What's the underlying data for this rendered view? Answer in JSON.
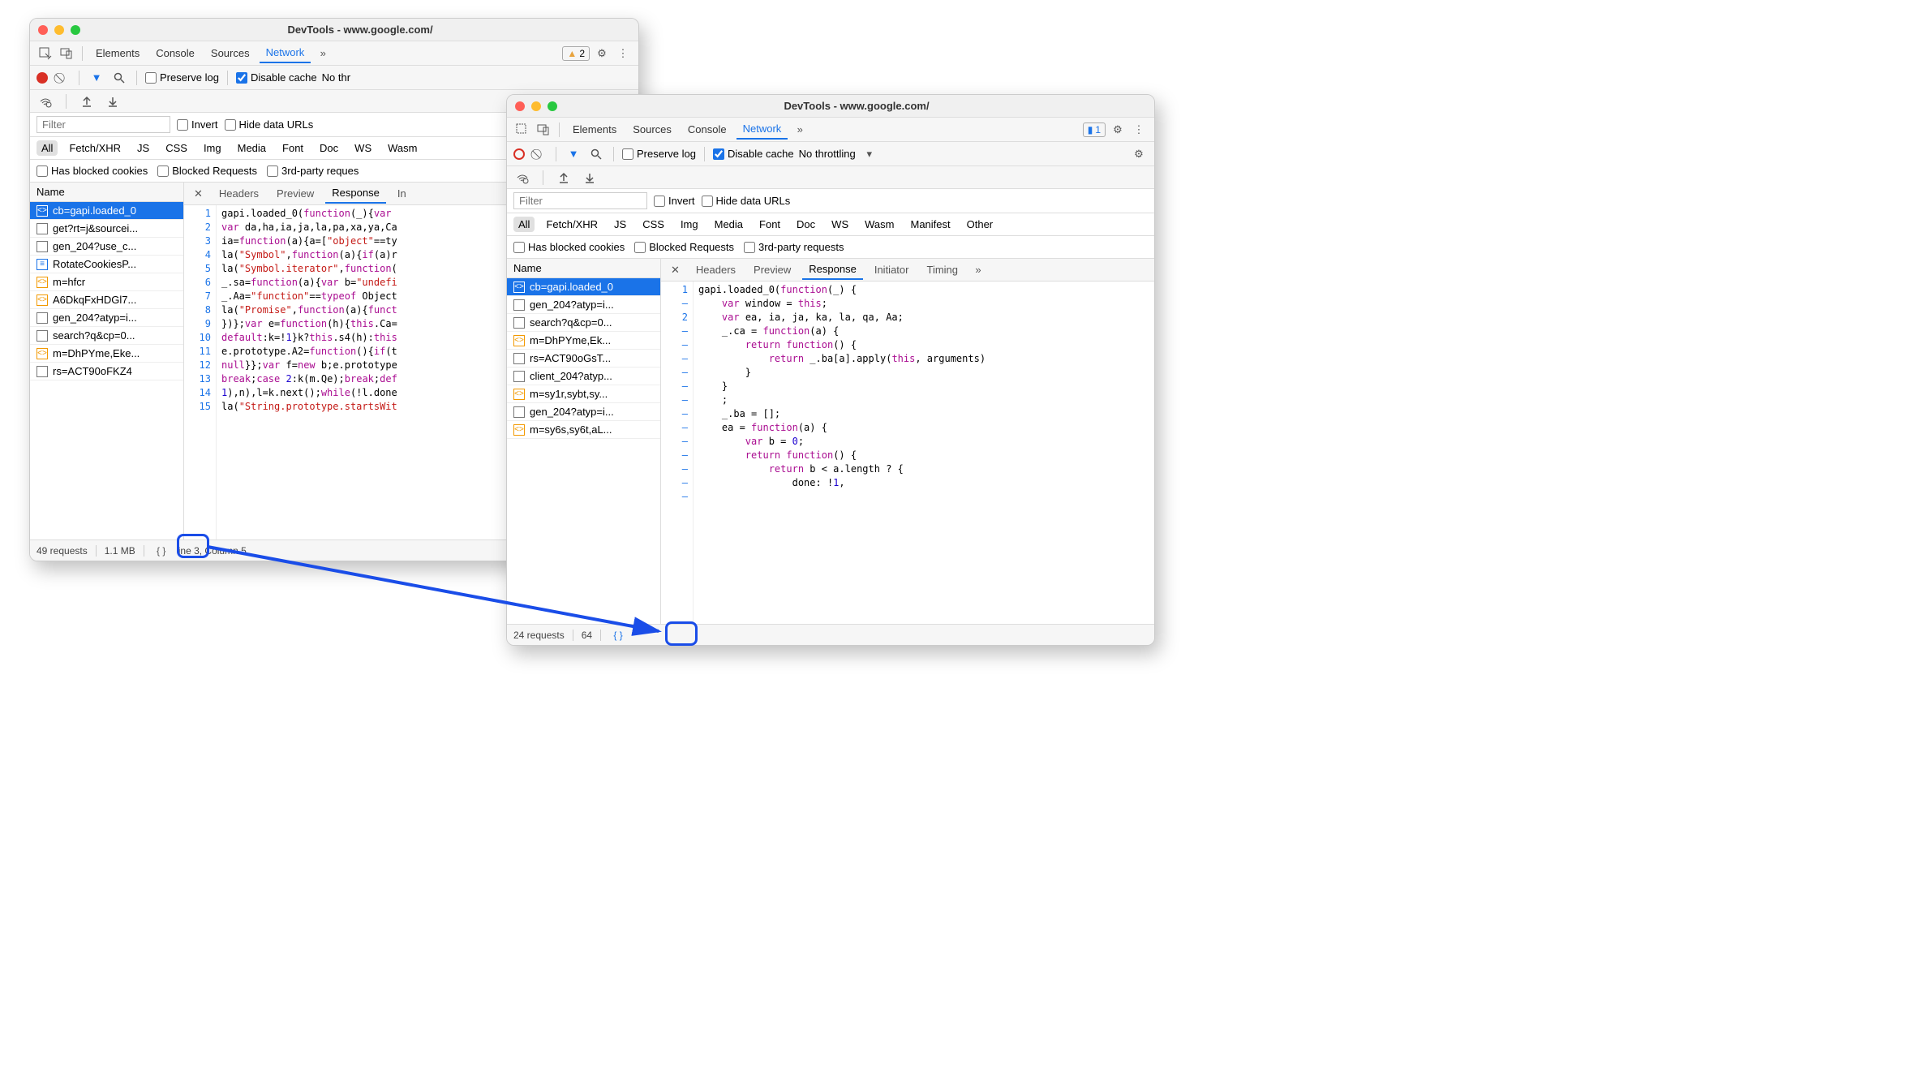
{
  "windowA": {
    "title": "DevTools - www.google.com/",
    "mainTabs": [
      "Elements",
      "Console",
      "Sources",
      "Network"
    ],
    "mainActive": "Network",
    "warnCount": "2",
    "preserveLog": "Preserve log",
    "disableCache": "Disable cache",
    "throttling": "No thr",
    "filterPlaceholder": "Filter",
    "invert": "Invert",
    "hideData": "Hide data URLs",
    "types": [
      "All",
      "Fetch/XHR",
      "JS",
      "CSS",
      "Img",
      "Media",
      "Font",
      "Doc",
      "WS",
      "Wasm"
    ],
    "typesActive": "All",
    "hasBlocked": "Has blocked cookies",
    "blockedReq": "Blocked Requests",
    "thirdParty": "3rd-party reques",
    "nameHead": "Name",
    "detailTabs": [
      "Headers",
      "Preview",
      "Response",
      "In"
    ],
    "detailActive": "Response",
    "files": [
      {
        "icon": "script",
        "label": "cb=gapi.loaded_0",
        "sel": true
      },
      {
        "icon": "doc",
        "label": "get?rt=j&sourcei..."
      },
      {
        "icon": "doc",
        "label": "gen_204?use_c..."
      },
      {
        "icon": "blue",
        "label": "RotateCookiesP..."
      },
      {
        "icon": "script",
        "label": "m=hfcr"
      },
      {
        "icon": "script",
        "label": "A6DkqFxHDGl7..."
      },
      {
        "icon": "doc",
        "label": "gen_204?atyp=i..."
      },
      {
        "icon": "doc",
        "label": "search?q&cp=0..."
      },
      {
        "icon": "script",
        "label": "m=DhPYme,Eke..."
      },
      {
        "icon": "doc",
        "label": "rs=ACT90oFKZ4"
      }
    ],
    "gutter": [
      "1",
      "2",
      "3",
      "4",
      "5",
      "6",
      "7",
      "8",
      "9",
      "10",
      "11",
      "12",
      "13",
      "14",
      "15"
    ],
    "status": {
      "requests": "49 requests",
      "transfer": "1.1 MB",
      "cursor": "ine 3, Column 5"
    }
  },
  "windowB": {
    "title": "DevTools - www.google.com/",
    "mainTabs": [
      "Elements",
      "Sources",
      "Console",
      "Network"
    ],
    "mainActive": "Network",
    "msgCount": "1",
    "preserveLog": "Preserve log",
    "disableCache": "Disable cache",
    "throttling": "No throttling",
    "filterPlaceholder": "Filter",
    "invert": "Invert",
    "hideData": "Hide data URLs",
    "types": [
      "All",
      "Fetch/XHR",
      "JS",
      "CSS",
      "Img",
      "Media",
      "Font",
      "Doc",
      "WS",
      "Wasm",
      "Manifest",
      "Other"
    ],
    "typesActive": "All",
    "hasBlocked": "Has blocked cookies",
    "blockedReq": "Blocked Requests",
    "thirdParty": "3rd-party requests",
    "nameHead": "Name",
    "detailTabs": [
      "Headers",
      "Preview",
      "Response",
      "Initiator",
      "Timing"
    ],
    "detailActive": "Response",
    "files": [
      {
        "icon": "script",
        "label": "cb=gapi.loaded_0",
        "sel": true
      },
      {
        "icon": "doc",
        "label": "gen_204?atyp=i..."
      },
      {
        "icon": "doc",
        "label": "search?q&cp=0..."
      },
      {
        "icon": "script",
        "label": "m=DhPYme,Ek..."
      },
      {
        "icon": "doc",
        "label": "rs=ACT90oGsT..."
      },
      {
        "icon": "doc",
        "label": "client_204?atyp..."
      },
      {
        "icon": "script",
        "label": "m=sy1r,sybt,sy..."
      },
      {
        "icon": "doc",
        "label": "gen_204?atyp=i..."
      },
      {
        "icon": "script",
        "label": "m=sy6s,sy6t,aL..."
      }
    ],
    "gutter": [
      "1",
      "–",
      "2",
      "–",
      "–",
      "–",
      "–",
      "–",
      "–",
      "–",
      "–",
      "–",
      "–",
      "–",
      "–",
      "–"
    ],
    "status": {
      "requests": "24 requests",
      "transfer": "64"
    }
  }
}
